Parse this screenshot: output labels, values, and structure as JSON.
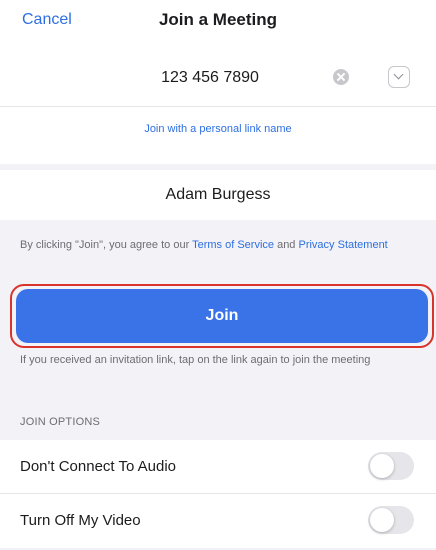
{
  "header": {
    "cancel_label": "Cancel",
    "title": "Join a Meeting"
  },
  "meeting_id": {
    "value": "123 456 7890",
    "clear_icon": "clear-circle-icon",
    "dropdown_icon": "chevron-down-icon"
  },
  "personal_link": {
    "label": "Join with a personal link name"
  },
  "display_name": {
    "value": "Adam Burgess"
  },
  "terms": {
    "prefix": "By clicking \"Join\", you agree to our ",
    "terms_link": "Terms of Service",
    "conjunction": " and ",
    "privacy_link": "Privacy Statement"
  },
  "join_button": {
    "label": "Join"
  },
  "invite_hint": "If you received an invitation link, tap on the link again to join the meeting",
  "join_options": {
    "header": "JOIN OPTIONS",
    "items": [
      {
        "label": "Don't Connect To Audio",
        "on": false
      },
      {
        "label": "Turn Off My Video",
        "on": false
      }
    ]
  },
  "colors": {
    "accent": "#2d6fe0",
    "join_button": "#3a72e8",
    "highlight": "#d9342b"
  }
}
